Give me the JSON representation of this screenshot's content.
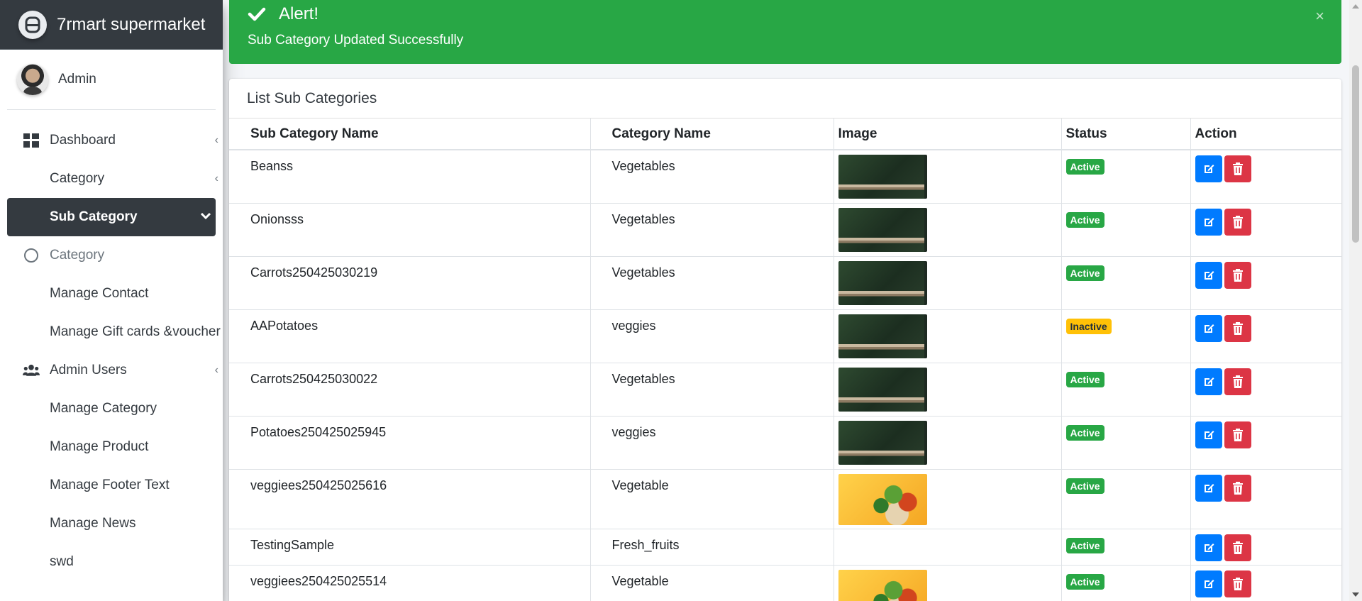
{
  "brand": {
    "name": "7rmart supermarket",
    "logo_icon": "brand-logo-icon"
  },
  "user": {
    "name": "Admin"
  },
  "sidebar": {
    "items": [
      {
        "label": "Dashboard",
        "icon": "dashboard-icon",
        "caret": "‹"
      },
      {
        "label": "Category",
        "caret": "‹"
      },
      {
        "label": "Sub Category",
        "caret": "chevron-down",
        "active": true
      },
      {
        "label": "Category",
        "icon": "circle-icon"
      },
      {
        "label": "Manage Contact"
      },
      {
        "label": "Manage Gift cards &voucher"
      },
      {
        "label": "Admin Users",
        "icon": "users-icon",
        "caret": "‹"
      },
      {
        "label": "Manage Category"
      },
      {
        "label": "Manage Product"
      },
      {
        "label": "Manage Footer Text"
      },
      {
        "label": "Manage News"
      },
      {
        "label": "swd"
      }
    ]
  },
  "alert": {
    "title": "Alert!",
    "message": "Sub Category Updated Successfully",
    "close": "×",
    "color": "#28a745"
  },
  "card": {
    "title": "List Sub Categories",
    "columns": [
      "Sub Category Name",
      "Category Name",
      "Image",
      "Status",
      "Action"
    ],
    "rows": [
      {
        "sub_category": "Beanss",
        "category": "Vegetables",
        "image": "dark-shelf",
        "status": "Active"
      },
      {
        "sub_category": "Onionsss",
        "category": "Vegetables",
        "image": "dark-shelf",
        "status": "Active"
      },
      {
        "sub_category": "Carrots250425030219",
        "category": "Vegetables",
        "image": "dark-shelf",
        "status": "Active"
      },
      {
        "sub_category": "AAPotatoes",
        "category": "veggies",
        "image": "dark-shelf",
        "status": "Inactive"
      },
      {
        "sub_category": "Carrots250425030022",
        "category": "Vegetables",
        "image": "dark-shelf",
        "status": "Active"
      },
      {
        "sub_category": "Potatoes250425025945",
        "category": "veggies",
        "image": "dark-shelf",
        "status": "Active"
      },
      {
        "sub_category": "veggiees250425025616",
        "category": "Vegetable",
        "image": "vegetable-bag",
        "status": "Active"
      },
      {
        "sub_category": "TestingSample",
        "category": "Fresh_fruits",
        "image": "",
        "status": "Active"
      },
      {
        "sub_category": "veggiees250425025514",
        "category": "Vegetable",
        "image": "vegetable-bag",
        "status": "Active"
      }
    ]
  },
  "colors": {
    "sidebar_dark": "#343a40",
    "success": "#28a745",
    "warning": "#ffc107",
    "primary": "#007bff",
    "danger": "#dc3545"
  }
}
